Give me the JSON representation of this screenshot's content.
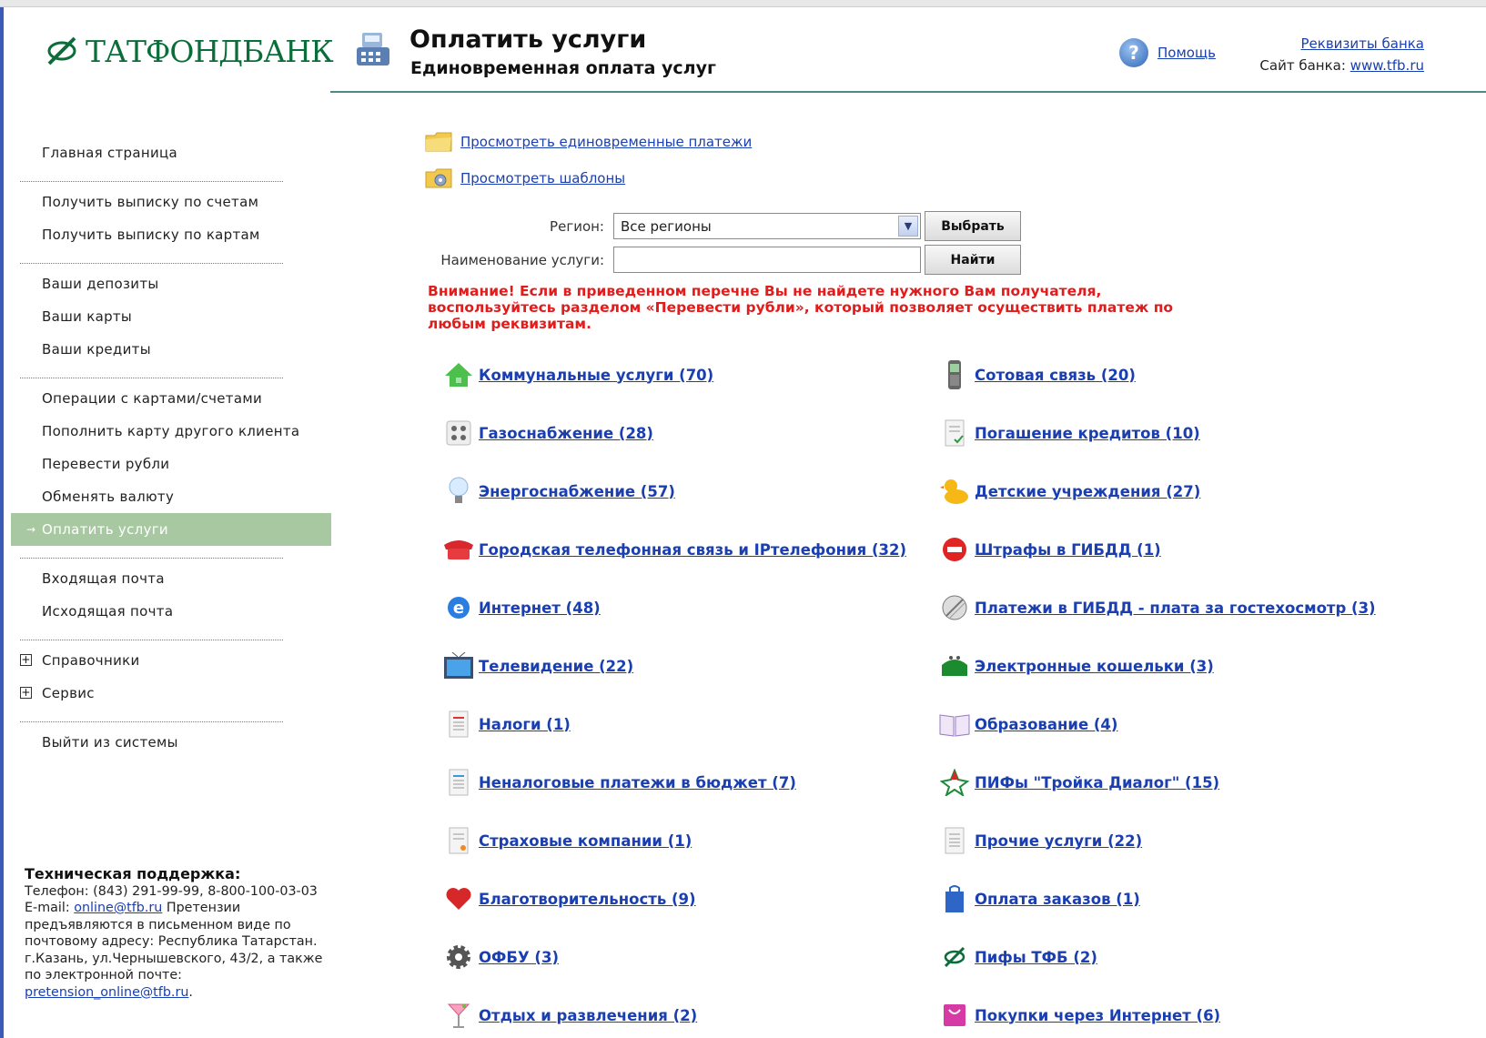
{
  "header": {
    "logo_text": "ТАТФОНДБАНК",
    "title": "Оплатить услуги",
    "subtitle": "Единовременная оплата услуг",
    "help_label": "Помощь",
    "bank_details_label": "Реквизиты банка",
    "site_label": "Сайт банка:",
    "site_link": "www.tfb.ru"
  },
  "menu": {
    "items": [
      "Главная страница",
      "Получить выписку по счетам",
      "Получить выписку по картам",
      "Ваши депозиты",
      "Ваши карты",
      "Ваши кредиты",
      "Операции с картами/счетами",
      "Пополнить карту другого клиента",
      "Перевести рубли",
      "Обменять валюту",
      "Оплатить услуги",
      "Входящая почта",
      "Исходящая почта",
      "Справочники",
      "Сервис",
      "Выйти из системы"
    ],
    "active": "Оплатить услуги"
  },
  "support": {
    "title": "Техническая поддержка:",
    "phone": "Телефон:  (843) 291-99-99, 8-800-100-03-03",
    "email_label": "E-mail:",
    "email": "online@tfb.ru",
    "text": "Претензии предъявляются в письменном виде по почтовому адресу: Республика Татарстан. г.Казань, ул.Чернышевского, 43/2, а также по электронной почте:",
    "claims_email": "pretension_online@tfb.ru",
    "dot": "."
  },
  "quick_links": {
    "payments": "Просмотреть единовременные платежи",
    "templates": "Просмотреть шаблоны"
  },
  "form": {
    "region_label": "Регион:",
    "region_value": "Все регионы",
    "select_button": "Выбрать",
    "service_label": "Наименование услуги:",
    "service_value": "",
    "find_button": "Найти"
  },
  "warning": "Внимание! Если в приведенном перечне Вы не найдете нужного Вам получателя, воспользуйтесь разделом «Перевести рубли», который позволяет осуществить платеж по любым реквизитам.",
  "services": {
    "left": [
      "Коммунальные услуги (70)",
      "Газоснабжение (28)",
      "Энергоснабжение (57)",
      "Городская телефонная связь и IPтелефония (32)",
      "Интернет (48)",
      "Телевидение (22)",
      "Налоги (1)",
      "Неналоговые платежи в бюджет (7)",
      "Страховые компании (1)",
      "Благотворительность (9)",
      "ОФБУ (3)",
      "Отдых и развлечения (2)"
    ],
    "right": [
      "Сотовая связь (20)",
      "Погашение кредитов (10)",
      "Детские учреждения (27)",
      "Штрафы в ГИБДД (1)",
      "Платежи в ГИБДД - плата за гостехосмотр (3)",
      "Электронные кошельки (3)",
      "Образование (4)",
      "ПИФы \"Тройка Диалог\" (15)",
      "Прочие услуги (22)",
      "Оплата заказов (1)",
      "Пифы ТФБ (2)",
      "Покупки через Интернет (6)"
    ]
  }
}
